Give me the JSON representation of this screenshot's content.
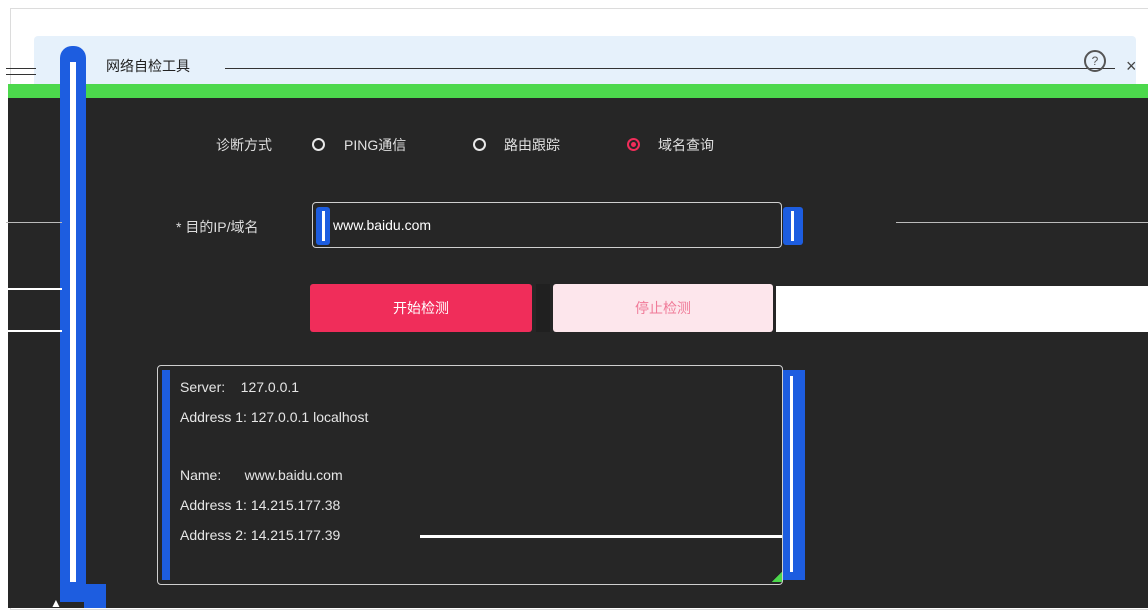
{
  "window": {
    "title": "网络自检工具"
  },
  "form": {
    "method_label": "诊断方式",
    "options": [
      {
        "label": "PING通信",
        "checked": false
      },
      {
        "label": "路由跟踪",
        "checked": false
      },
      {
        "label": "域名查询",
        "checked": true
      }
    ],
    "target_label": "* 目的IP/域名",
    "target_value": "www.baidu.com",
    "start_button": "开始检测",
    "stop_button": "停止检测"
  },
  "output": {
    "lines": [
      "Server:    127.0.0.1",
      "Address 1: 127.0.0.1 localhost",
      "",
      "Name:      www.baidu.com",
      "Address 1: 14.215.177.38",
      "Address 2: 14.215.177.39"
    ]
  },
  "colors": {
    "accent": "#f02d5a",
    "panel_bg": "#262626",
    "titlebar_bg": "#e6f1fb",
    "green_bar": "#4cd84c",
    "blue_rail": "#1d5de0"
  },
  "icons": {
    "help": "help-icon",
    "close": "close-icon"
  }
}
